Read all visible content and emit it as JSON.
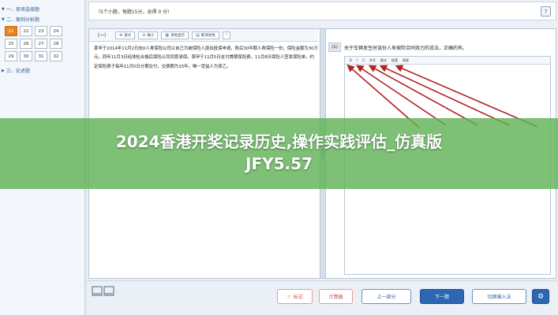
{
  "sidebar": {
    "section1": "一、单项选择题",
    "section2": "二、案例分析题",
    "numbers": [
      "21",
      "22",
      "23",
      "24",
      "25",
      "26",
      "27",
      "28",
      "29",
      "30",
      "31",
      "32"
    ],
    "active_number": "21",
    "section3": "三、论述题"
  },
  "header": {
    "info": "（5个小题，每题15分，总得 0 分）",
    "help_icon": "?"
  },
  "toolbar": {
    "question_label": "（一）",
    "zoom_in": "放大",
    "zoom_out": "缩小",
    "highlight": "涂色显示",
    "clear": "取消涂色"
  },
  "passage": "某甲于2014年11月2日向X人寿保险公司以自己为被保险人提出投保申请，购买30年期人寿保险一份，保险金额为30万元。同年11月3日经体检合格后保险公司同意承保。某甲于11月5日支付首期保险费。11月8日保险人签发保险单。约定保险费于每年11月5日分期交付，交费期为15年。唯一受益人为某乙。",
  "question": {
    "number": "(1)",
    "text": "关于车辆发生时该份人寿保险合同效力的说法，正确的有。"
  },
  "editor_toolbar": [
    "B",
    "I",
    "U",
    "字号",
    "格式",
    "段落",
    "表格"
  ],
  "footer": {
    "mark": "标记",
    "calc": "计算器",
    "prev": "上一部分",
    "next": "下一题",
    "switch_input": "切换输入法",
    "gear_icon": "⚙"
  },
  "banner": {
    "title_line1": "2024香港开奖记录历史,操作实践评估_仿真版",
    "title_line2": "JFY5.57"
  },
  "colors": {
    "accent": "#2d67b2",
    "active_number": "#e8841f",
    "banner": "#60b258",
    "arrow": "#b22222"
  }
}
